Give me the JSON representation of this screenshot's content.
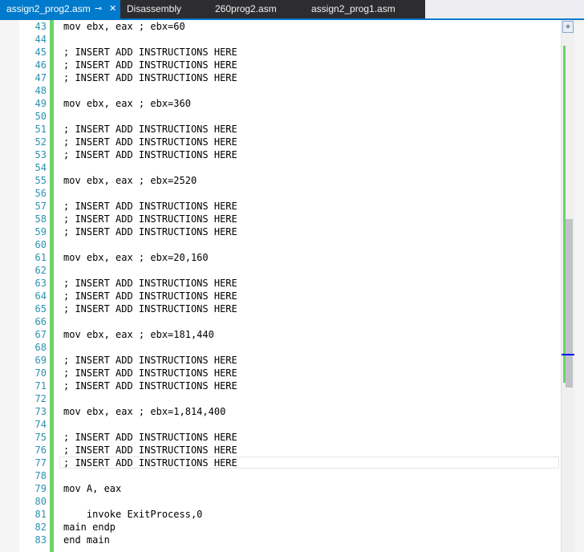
{
  "tabs": [
    {
      "label": "assign2_prog2.asm",
      "pin": "⊸",
      "close": "✕",
      "active": true
    },
    {
      "label": "Disassembly",
      "active": false
    },
    {
      "label": "260prog2.asm",
      "active": false
    },
    {
      "label": "assign2_prog1.asm",
      "active": false
    }
  ],
  "editor": {
    "current_line": 77,
    "lines": [
      {
        "n": "43",
        "t": "mov ebx, eax ; ebx=60"
      },
      {
        "n": "44",
        "t": ""
      },
      {
        "n": "45",
        "t": "; INSERT ADD INSTRUCTIONS HERE"
      },
      {
        "n": "46",
        "t": "; INSERT ADD INSTRUCTIONS HERE"
      },
      {
        "n": "47",
        "t": "; INSERT ADD INSTRUCTIONS HERE"
      },
      {
        "n": "48",
        "t": ""
      },
      {
        "n": "49",
        "t": "mov ebx, eax ; ebx=360"
      },
      {
        "n": "50",
        "t": ""
      },
      {
        "n": "51",
        "t": "; INSERT ADD INSTRUCTIONS HERE"
      },
      {
        "n": "52",
        "t": "; INSERT ADD INSTRUCTIONS HERE"
      },
      {
        "n": "53",
        "t": "; INSERT ADD INSTRUCTIONS HERE"
      },
      {
        "n": "54",
        "t": ""
      },
      {
        "n": "55",
        "t": "mov ebx, eax ; ebx=2520"
      },
      {
        "n": "56",
        "t": ""
      },
      {
        "n": "57",
        "t": "; INSERT ADD INSTRUCTIONS HERE"
      },
      {
        "n": "58",
        "t": "; INSERT ADD INSTRUCTIONS HERE"
      },
      {
        "n": "59",
        "t": "; INSERT ADD INSTRUCTIONS HERE"
      },
      {
        "n": "60",
        "t": ""
      },
      {
        "n": "61",
        "t": "mov ebx, eax ; ebx=20,160"
      },
      {
        "n": "62",
        "t": ""
      },
      {
        "n": "63",
        "t": "; INSERT ADD INSTRUCTIONS HERE"
      },
      {
        "n": "64",
        "t": "; INSERT ADD INSTRUCTIONS HERE"
      },
      {
        "n": "65",
        "t": "; INSERT ADD INSTRUCTIONS HERE"
      },
      {
        "n": "66",
        "t": ""
      },
      {
        "n": "67",
        "t": "mov ebx, eax ; ebx=181,440"
      },
      {
        "n": "68",
        "t": ""
      },
      {
        "n": "69",
        "t": "; INSERT ADD INSTRUCTIONS HERE"
      },
      {
        "n": "70",
        "t": "; INSERT ADD INSTRUCTIONS HERE"
      },
      {
        "n": "71",
        "t": "; INSERT ADD INSTRUCTIONS HERE"
      },
      {
        "n": "72",
        "t": ""
      },
      {
        "n": "73",
        "t": "mov ebx, eax ; ebx=1,814,400"
      },
      {
        "n": "74",
        "t": ""
      },
      {
        "n": "75",
        "t": "; INSERT ADD INSTRUCTIONS HERE"
      },
      {
        "n": "76",
        "t": "; INSERT ADD INSTRUCTIONS HERE"
      },
      {
        "n": "77",
        "t": "; INSERT ADD INSTRUCTIONS HERE"
      },
      {
        "n": "78",
        "t": ""
      },
      {
        "n": "79",
        "t": "mov A, eax"
      },
      {
        "n": "80",
        "t": ""
      },
      {
        "n": "81",
        "t": "    invoke ExitProcess,0"
      },
      {
        "n": "82",
        "t": "main endp"
      },
      {
        "n": "83",
        "t": "end main"
      }
    ]
  },
  "scrollbar": {
    "split_glyph": "÷"
  },
  "colors": {
    "accent": "#007acc",
    "line_number": "#2b91af",
    "change_bar": "#6ad46a"
  }
}
